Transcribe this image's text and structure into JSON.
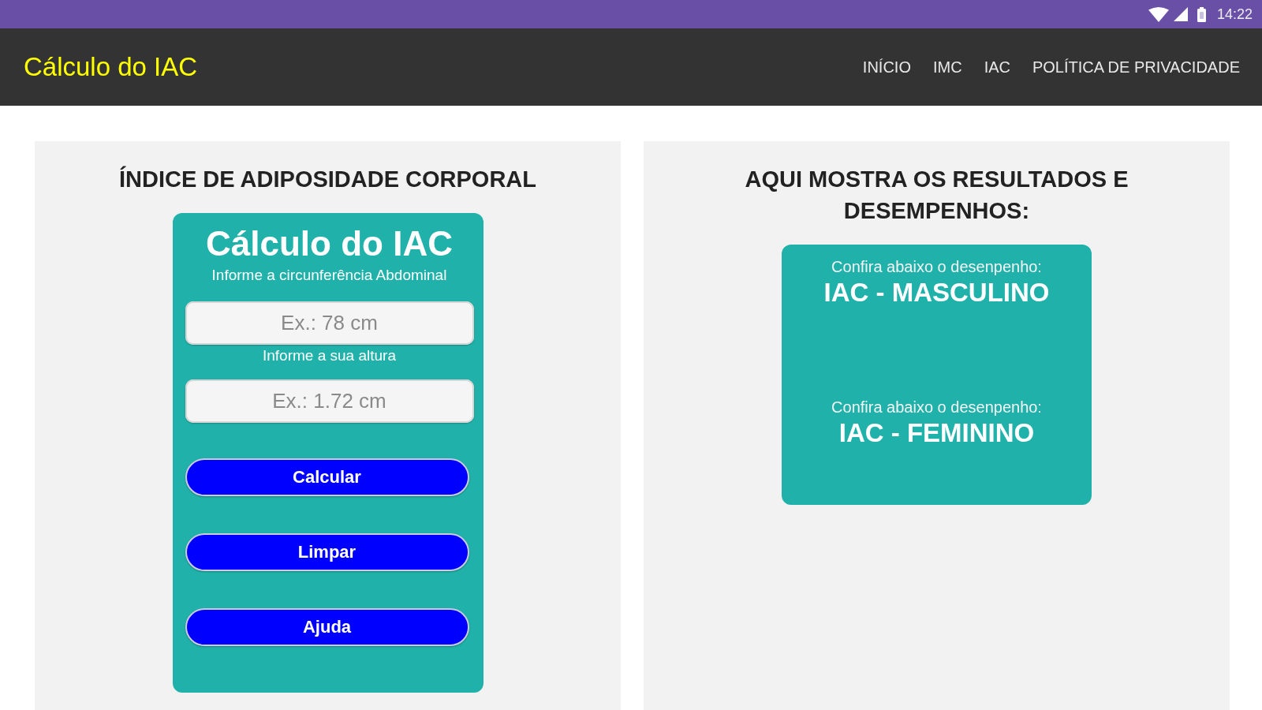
{
  "status_bar": {
    "time": "14:22"
  },
  "app_bar": {
    "title": "Cálculo do IAC",
    "nav": [
      "INÍCIO",
      "IMC",
      "IAC",
      "POLÍTICA DE PRIVACIDADE"
    ]
  },
  "calculator": {
    "heading": "ÍNDICE DE ADIPOSIDADE CORPORAL",
    "card": {
      "title": "Cálculo do IAC",
      "fields": [
        {
          "label": "Informe a circunferência Abdominal",
          "placeholder": "Ex.: 78 cm"
        },
        {
          "label": "Informe a sua altura",
          "placeholder": "Ex.: 1.72 cm"
        }
      ],
      "buttons": [
        "Calcular",
        "Limpar",
        "Ajuda"
      ]
    }
  },
  "results": {
    "heading": "AQUI MOSTRA OS RESULTADOS E DESEMPENHOS:",
    "sections": [
      {
        "caption": "Confira abaixo o desenpenho:",
        "title": "IAC - MASCULINO"
      },
      {
        "caption": "Confira abaixo o desenpenho:",
        "title": "IAC - FEMININO"
      }
    ]
  }
}
